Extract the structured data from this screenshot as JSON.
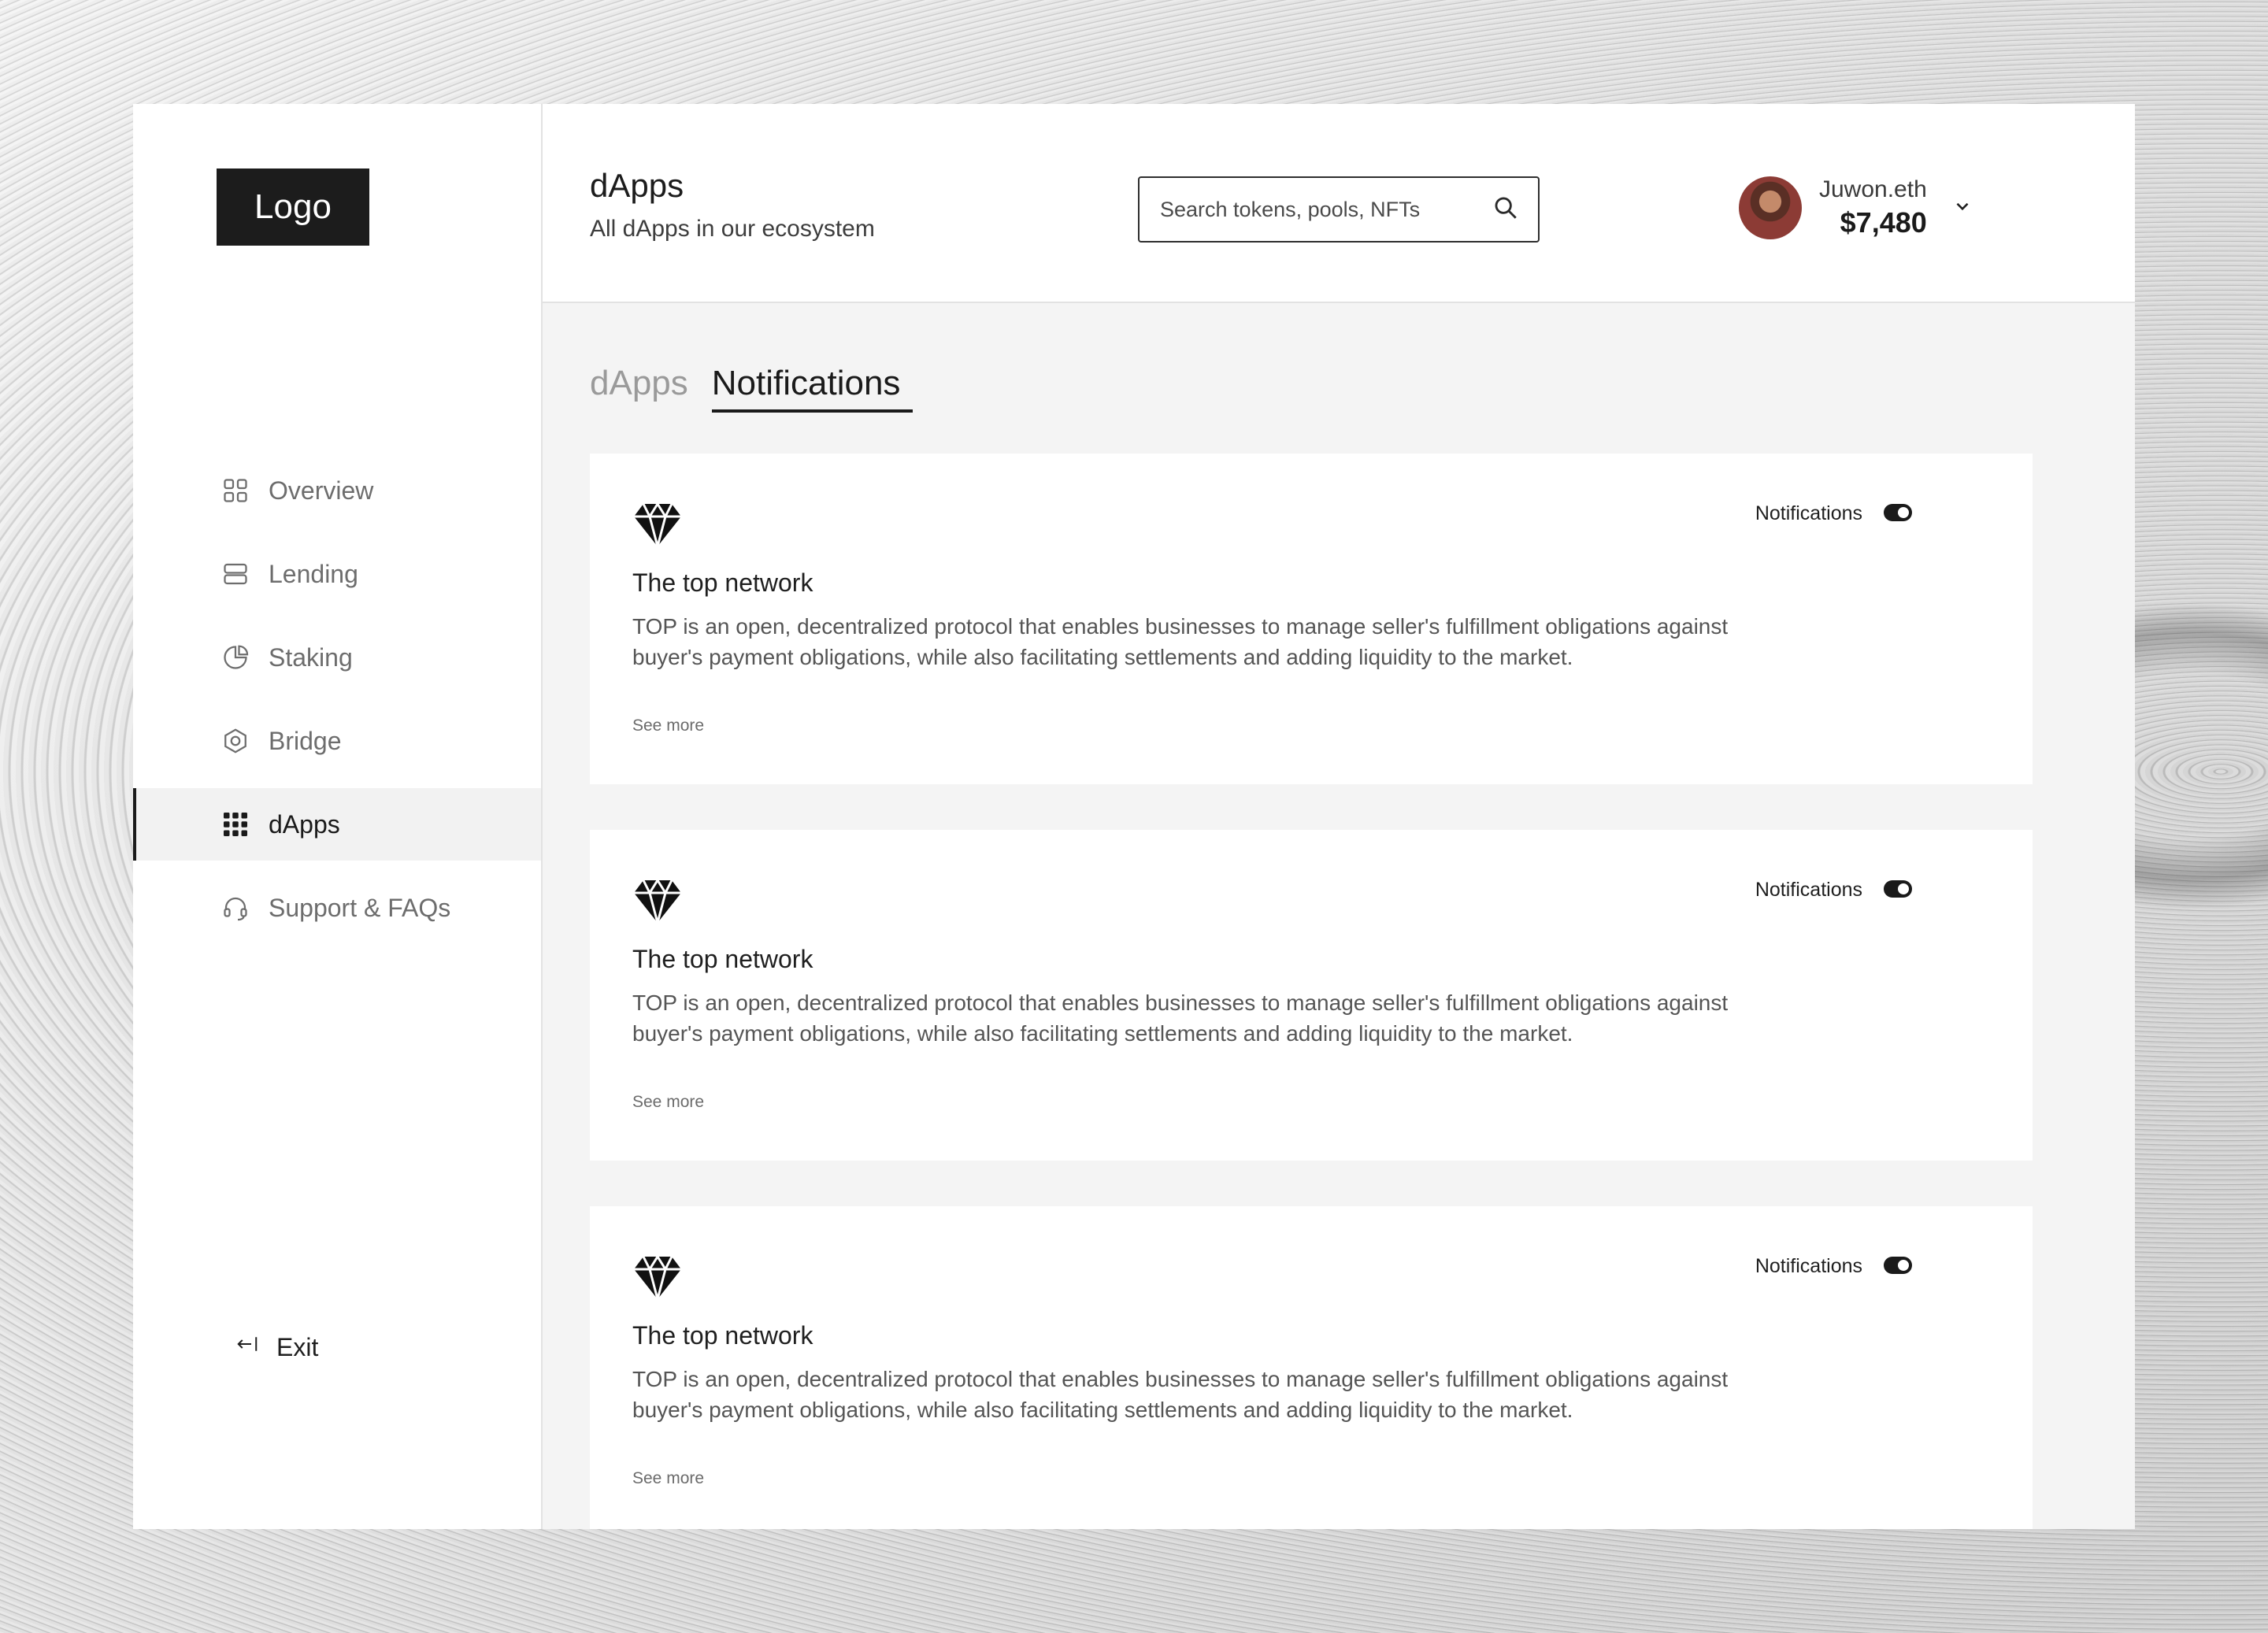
{
  "sidebar": {
    "logo": "Logo",
    "items": [
      {
        "label": "Overview"
      },
      {
        "label": "Lending"
      },
      {
        "label": "Staking"
      },
      {
        "label": "Bridge"
      },
      {
        "label": "dApps"
      },
      {
        "label": "Support & FAQs"
      }
    ],
    "active_item": "dApps",
    "exit_label": "Exit"
  },
  "header": {
    "title": "dApps",
    "subtitle": "All dApps in our ecosystem",
    "search": {
      "placeholder": "Search tokens, pools, NFTs",
      "value": ""
    },
    "user": {
      "name": "Juwon.eth",
      "balance": "$7,480"
    }
  },
  "tabs": [
    {
      "label": "dApps"
    },
    {
      "label": "Notifications"
    }
  ],
  "active_tab": "Notifications",
  "cards": [
    {
      "title": "The top network",
      "description": "TOP is an open, decentralized protocol that enables businesses to manage seller's fulfillment obligations against buyer's payment obligations, while also facilitating settlements and adding liquidity to the market.",
      "link": "See more",
      "toggle_label": "Notifications",
      "toggle_on": true
    },
    {
      "title": "The top network",
      "description": "TOP is an open, decentralized protocol that enables businesses to manage seller's fulfillment obligations against buyer's payment obligations, while also facilitating settlements and adding liquidity to the market.",
      "link": "See more",
      "toggle_label": "Notifications",
      "toggle_on": true
    },
    {
      "title": "The top network",
      "description": "TOP is an open, decentralized protocol that enables businesses to manage seller's fulfillment obligations against buyer's payment obligations, while also facilitating settlements and adding liquidity to the market.",
      "link": "See more",
      "toggle_label": "Notifications",
      "toggle_on": true
    }
  ],
  "colors": {
    "accent": "#1a1a1a",
    "surface": "#ffffff",
    "canvas": "#f4f4f4",
    "muted_text": "#6d6d6d"
  },
  "icons": {
    "nav": [
      "grid-icon",
      "server-icon",
      "pie-chart-icon",
      "hexagon-icon",
      "dots-grid-icon",
      "headset-icon"
    ],
    "exit": "exit-arrow-icon",
    "search": "search-icon",
    "card": "diamond-icon",
    "user_menu": "chevron-down-icon"
  }
}
